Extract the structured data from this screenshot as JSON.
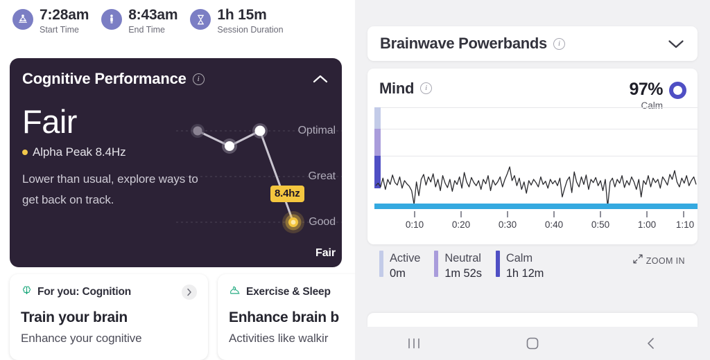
{
  "session_summary": {
    "stats": [
      {
        "icon": "meditation-icon",
        "value": "7:28am",
        "label": "Start Time"
      },
      {
        "icon": "person-standing-icon",
        "value": "8:43am",
        "label": "End Time"
      },
      {
        "icon": "hourglass-icon",
        "value": "1h 15m",
        "label": "Session Duration"
      }
    ],
    "icon_bg_color": "#7b7ec4"
  },
  "cognitive_card": {
    "title": "Cognitive Performance",
    "info_icon": "info-icon",
    "collapse_icon": "chevron-up-icon",
    "score": "Fair",
    "metric_label": "Alpha Peak 8.4Hz",
    "metric_dot_color": "#f2c84b",
    "description": "Lower than usual, explore ways to get back on track.",
    "background_color": "#2c2236",
    "badge_label": "8.4hz",
    "badge_color": "#f4c63f",
    "zones": [
      {
        "label": "Optimal",
        "current": false
      },
      {
        "label": "Great",
        "current": false
      },
      {
        "label": "Good",
        "current": false
      },
      {
        "label": "Fair",
        "current": true
      }
    ],
    "trend_points": [
      {
        "x": 31,
        "y": 41,
        "state": "dim"
      },
      {
        "x": 77,
        "y": 63,
        "state": "normal"
      },
      {
        "x": 121,
        "y": 41,
        "state": "normal"
      },
      {
        "x": 169,
        "y": 173,
        "state": "highlight"
      }
    ]
  },
  "recommendations": [
    {
      "icon": "brain-icon",
      "icon_color": "#1fa97e",
      "category": "For you: Cognition",
      "title": "Train your brain",
      "subtitle": "Enhance your cognitive",
      "has_chevron": true,
      "chevron_icon": "chevron-right-icon"
    },
    {
      "icon": "sneaker-icon",
      "icon_color": "#1fa97e",
      "category": "Exercise & Sleep",
      "title": "Enhance brain b",
      "subtitle": "Activities like walkir",
      "has_chevron": false,
      "chevron_icon": ""
    }
  ],
  "powerbands": {
    "title": "Brainwave Powerbands",
    "info_icon": "info-icon",
    "expand_icon": "chevron-down-icon"
  },
  "mind_card": {
    "title": "Mind",
    "info_icon": "info-icon",
    "percent": "97%",
    "state": "Calm",
    "ring_color": "#4f4fc4"
  },
  "legend": {
    "items": [
      {
        "name": "Active",
        "value": "0m",
        "color": "#c3cbe8"
      },
      {
        "name": "Neutral",
        "value": "1m 52s",
        "color": "#a99cdb"
      },
      {
        "name": "Calm",
        "value": "1h 12m",
        "color": "#4f4fc4"
      }
    ],
    "zoom_in_label": "ZOOM IN",
    "zoom_in_icon": "expand-arrows-icon"
  },
  "nav_bar": {
    "buttons": [
      {
        "icon": "recents-icon",
        "label": "Recents"
      },
      {
        "icon": "home-icon",
        "label": "Home"
      },
      {
        "icon": "back-icon",
        "label": "Back"
      }
    ]
  },
  "chart_data": {
    "type": "line",
    "title": "Mind",
    "xlabel": "",
    "ylabel": "",
    "xtick_labels": [
      "0:10",
      "0:20",
      "0:30",
      "0:40",
      "0:50",
      "1:00",
      "1:10"
    ],
    "xtick_positions": [
      58,
      125,
      192,
      259,
      326,
      393,
      460
    ],
    "xlim": [
      "0:00",
      "1:15"
    ],
    "grid": true,
    "legend_position": "below",
    "zone_bands": [
      {
        "name": "Active",
        "color": "#c3cbe8",
        "from_pct": 0,
        "to_pct": 36
      },
      {
        "name": "Neutral",
        "color": "#a99cdb",
        "from_pct": 36,
        "to_pct": 66
      },
      {
        "name": "Calm",
        "color": "#4f4fc4",
        "from_pct": 66,
        "to_pct": 100
      }
    ],
    "calm_band_color": "#34a9e0",
    "series": [
      {
        "name": "EEG signal",
        "color": "#2a2a2e",
        "values": [
          78,
          82,
          76,
          90,
          72,
          88,
          80,
          95,
          83,
          79,
          92,
          74,
          86,
          81,
          77,
          70,
          48,
          84,
          62,
          88,
          96,
          79,
          92,
          84,
          97,
          76,
          88,
          70,
          94,
          82,
          75,
          88,
          69,
          86,
          80,
          92,
          74,
          99,
          84,
          76,
          91,
          83,
          78,
          86,
          72,
          88,
          81,
          94,
          70,
          87,
          79,
          84,
          92,
          76,
          88,
          97,
          108,
          86,
          94,
          78,
          90,
          72,
          84,
          66,
          86,
          79,
          88,
          83,
          76,
          92,
          80,
          85,
          74,
          88,
          81,
          86,
          78,
          90,
          60,
          74,
          86,
          92,
          67,
          100,
          84,
          76,
          92,
          80,
          95,
          72,
          88,
          83,
          91,
          78,
          86,
          70,
          88,
          44,
          84,
          90,
          76,
          88,
          82,
          94,
          75,
          86,
          79,
          92,
          84,
          72,
          88,
          60,
          86,
          80,
          94,
          76,
          90,
          83,
          88,
          74,
          92,
          86,
          79,
          96,
          88,
          102,
          84,
          76,
          90,
          82,
          94,
          78,
          86,
          92,
          80
        ]
      }
    ],
    "summary_durations": [
      {
        "state": "Active",
        "duration": "0m"
      },
      {
        "state": "Neutral",
        "duration": "1m 52s"
      },
      {
        "state": "Calm",
        "duration": "1h 12m"
      }
    ],
    "score_percent": 97,
    "score_state": "Calm"
  },
  "cognitive_chart_data": {
    "type": "line",
    "title": "Cognitive Performance trend",
    "categories": [
      "",
      "",
      "",
      ""
    ],
    "values": [
      "Optimal-",
      "Great",
      "Optimal-",
      "Fair"
    ],
    "ytick_labels": [
      "Optimal",
      "Great",
      "Good",
      "Fair"
    ],
    "highlight_label": "8.4hz",
    "highlight_index": 3
  }
}
